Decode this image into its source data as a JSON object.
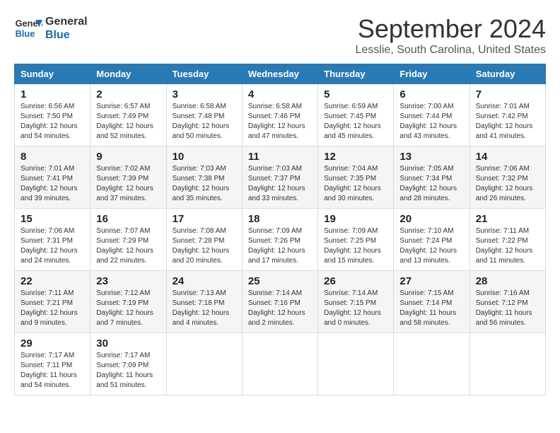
{
  "logo": {
    "line1": "General",
    "line2": "Blue"
  },
  "title": "September 2024",
  "location": "Lesslie, South Carolina, United States",
  "days_header": [
    "Sunday",
    "Monday",
    "Tuesday",
    "Wednesday",
    "Thursday",
    "Friday",
    "Saturday"
  ],
  "weeks": [
    [
      {
        "day": "1",
        "info": "Sunrise: 6:56 AM\nSunset: 7:50 PM\nDaylight: 12 hours\nand 54 minutes."
      },
      {
        "day": "2",
        "info": "Sunrise: 6:57 AM\nSunset: 7:49 PM\nDaylight: 12 hours\nand 52 minutes."
      },
      {
        "day": "3",
        "info": "Sunrise: 6:58 AM\nSunset: 7:48 PM\nDaylight: 12 hours\nand 50 minutes."
      },
      {
        "day": "4",
        "info": "Sunrise: 6:58 AM\nSunset: 7:46 PM\nDaylight: 12 hours\nand 47 minutes."
      },
      {
        "day": "5",
        "info": "Sunrise: 6:59 AM\nSunset: 7:45 PM\nDaylight: 12 hours\nand 45 minutes."
      },
      {
        "day": "6",
        "info": "Sunrise: 7:00 AM\nSunset: 7:44 PM\nDaylight: 12 hours\nand 43 minutes."
      },
      {
        "day": "7",
        "info": "Sunrise: 7:01 AM\nSunset: 7:42 PM\nDaylight: 12 hours\nand 41 minutes."
      }
    ],
    [
      {
        "day": "8",
        "info": "Sunrise: 7:01 AM\nSunset: 7:41 PM\nDaylight: 12 hours\nand 39 minutes."
      },
      {
        "day": "9",
        "info": "Sunrise: 7:02 AM\nSunset: 7:39 PM\nDaylight: 12 hours\nand 37 minutes."
      },
      {
        "day": "10",
        "info": "Sunrise: 7:03 AM\nSunset: 7:38 PM\nDaylight: 12 hours\nand 35 minutes."
      },
      {
        "day": "11",
        "info": "Sunrise: 7:03 AM\nSunset: 7:37 PM\nDaylight: 12 hours\nand 33 minutes."
      },
      {
        "day": "12",
        "info": "Sunrise: 7:04 AM\nSunset: 7:35 PM\nDaylight: 12 hours\nand 30 minutes."
      },
      {
        "day": "13",
        "info": "Sunrise: 7:05 AM\nSunset: 7:34 PM\nDaylight: 12 hours\nand 28 minutes."
      },
      {
        "day": "14",
        "info": "Sunrise: 7:06 AM\nSunset: 7:32 PM\nDaylight: 12 hours\nand 26 minutes."
      }
    ],
    [
      {
        "day": "15",
        "info": "Sunrise: 7:06 AM\nSunset: 7:31 PM\nDaylight: 12 hours\nand 24 minutes."
      },
      {
        "day": "16",
        "info": "Sunrise: 7:07 AM\nSunset: 7:29 PM\nDaylight: 12 hours\nand 22 minutes."
      },
      {
        "day": "17",
        "info": "Sunrise: 7:08 AM\nSunset: 7:28 PM\nDaylight: 12 hours\nand 20 minutes."
      },
      {
        "day": "18",
        "info": "Sunrise: 7:09 AM\nSunset: 7:26 PM\nDaylight: 12 hours\nand 17 minutes."
      },
      {
        "day": "19",
        "info": "Sunrise: 7:09 AM\nSunset: 7:25 PM\nDaylight: 12 hours\nand 15 minutes."
      },
      {
        "day": "20",
        "info": "Sunrise: 7:10 AM\nSunset: 7:24 PM\nDaylight: 12 hours\nand 13 minutes."
      },
      {
        "day": "21",
        "info": "Sunrise: 7:11 AM\nSunset: 7:22 PM\nDaylight: 12 hours\nand 11 minutes."
      }
    ],
    [
      {
        "day": "22",
        "info": "Sunrise: 7:11 AM\nSunset: 7:21 PM\nDaylight: 12 hours\nand 9 minutes."
      },
      {
        "day": "23",
        "info": "Sunrise: 7:12 AM\nSunset: 7:19 PM\nDaylight: 12 hours\nand 7 minutes."
      },
      {
        "day": "24",
        "info": "Sunrise: 7:13 AM\nSunset: 7:18 PM\nDaylight: 12 hours\nand 4 minutes."
      },
      {
        "day": "25",
        "info": "Sunrise: 7:14 AM\nSunset: 7:16 PM\nDaylight: 12 hours\nand 2 minutes."
      },
      {
        "day": "26",
        "info": "Sunrise: 7:14 AM\nSunset: 7:15 PM\nDaylight: 12 hours\nand 0 minutes."
      },
      {
        "day": "27",
        "info": "Sunrise: 7:15 AM\nSunset: 7:14 PM\nDaylight: 11 hours\nand 58 minutes."
      },
      {
        "day": "28",
        "info": "Sunrise: 7:16 AM\nSunset: 7:12 PM\nDaylight: 11 hours\nand 56 minutes."
      }
    ],
    [
      {
        "day": "29",
        "info": "Sunrise: 7:17 AM\nSunset: 7:11 PM\nDaylight: 11 hours\nand 54 minutes."
      },
      {
        "day": "30",
        "info": "Sunrise: 7:17 AM\nSunset: 7:09 PM\nDaylight: 11 hours\nand 51 minutes."
      },
      null,
      null,
      null,
      null,
      null
    ]
  ]
}
